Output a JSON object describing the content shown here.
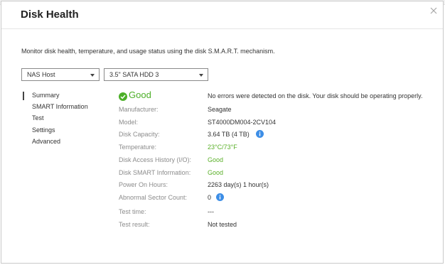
{
  "dialog": {
    "title": "Disk Health",
    "description": "Monitor disk health, temperature, and usage status using the disk S.M.A.R.T. mechanism."
  },
  "selectors": {
    "host": "NAS Host",
    "disk": "3.5\" SATA HDD 3"
  },
  "nav": {
    "items": [
      "Summary",
      "SMART Information",
      "Test",
      "Settings",
      "Advanced"
    ],
    "active": "Summary"
  },
  "status": {
    "label": "Good",
    "message": "No errors were detected on the disk. Your disk should be operating properly.",
    "color": "#4caf28"
  },
  "details": [
    {
      "label": "Manufacturer:",
      "value": "Seagate"
    },
    {
      "label": "Model:",
      "value": "ST4000DM004-2CV104"
    },
    {
      "label": "Disk Capacity:",
      "value": "3.64 TB (4 TB)"
    },
    {
      "label": "Temperature:",
      "value": "23°C/73°F"
    },
    {
      "label": "Disk Access History (I/O):",
      "value": "Good"
    },
    {
      "label": "Disk SMART Information:",
      "value": "Good"
    },
    {
      "label": "Power On Hours:",
      "value": "2263 day(s) 1 hour(s)"
    },
    {
      "label": "Abnormal Sector Count:",
      "value": "0"
    },
    {
      "label": "Test time:",
      "value": "---"
    },
    {
      "label": "Test result:",
      "value": "Not tested"
    }
  ],
  "icons": {
    "info": "info-icon",
    "status": "check-circle-icon",
    "close": "close-icon"
  },
  "colors": {
    "good": "#5bb02a",
    "info": "#3d8ee6"
  }
}
